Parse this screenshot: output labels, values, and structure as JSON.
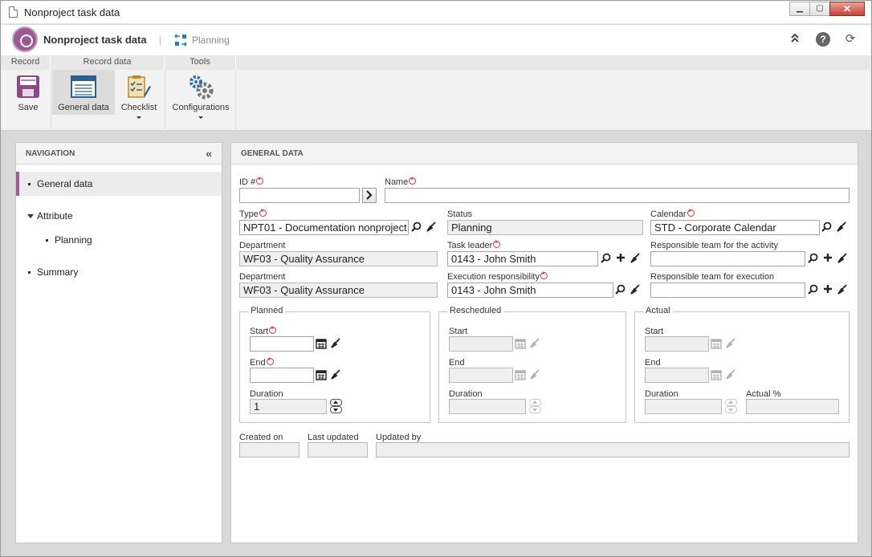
{
  "window": {
    "title": "Nonproject task data",
    "minimize": "▁",
    "maximize": "▢",
    "close": "✕"
  },
  "appbar": {
    "title": "Nonproject task data",
    "separator": "|",
    "breadcrumb": "Planning",
    "collapse_icon": "«",
    "help_icon": "?",
    "refresh_icon": "⟳",
    "up_icon": "⌃"
  },
  "ribbon": {
    "groups": [
      "Record",
      "Record data",
      "Tools"
    ],
    "buttons": {
      "save": "Save",
      "general_data": "General data",
      "checklist": "Checklist",
      "configurations": "Configurations"
    }
  },
  "navigation": {
    "heading": "NAVIGATION",
    "collapse_icon": "«",
    "items": [
      {
        "label": "General data",
        "active": true
      },
      {
        "label": "Attribute"
      },
      {
        "label": "Planning"
      },
      {
        "label": "Summary"
      }
    ]
  },
  "general": {
    "heading": "GENERAL DATA",
    "id_label": "ID #",
    "id_value": "",
    "name_label": "Name",
    "name_value": "",
    "type_label": "Type",
    "type_value": "NPT01 - Documentation nonproject",
    "status_label": "Status",
    "status_value": "Planning",
    "calendar_label": "Calendar",
    "calendar_value": "STD - Corporate Calendar",
    "department_label": "Department",
    "department_value": "WF03 - Quality Assurance",
    "task_leader_label": "Task leader",
    "task_leader_value": "0143 - John Smith",
    "resp_team_activity_label": "Responsible team for the activity",
    "resp_team_activity_value": "",
    "department2_label": "Department",
    "department2_value": "WF03 - Quality Assurance",
    "exec_resp_label": "Execution responsibility",
    "exec_resp_value": "0143 - John Smith",
    "resp_team_exec_label": "Responsible team for execution",
    "resp_team_exec_value": "",
    "planned": {
      "title": "Planned",
      "start_label": "Start",
      "start_value": "",
      "end_label": "End",
      "end_value": "",
      "duration_label": "Duration",
      "duration_value": "1"
    },
    "rescheduled": {
      "title": "Rescheduled",
      "start_label": "Start",
      "end_label": "End",
      "duration_label": "Duration"
    },
    "actual": {
      "title": "Actual",
      "start_label": "Start",
      "end_label": "End",
      "duration_label": "Duration",
      "actual_pct_label": "Actual %"
    },
    "created_on_label": "Created on",
    "created_on_value": "",
    "last_updated_label": "Last updated",
    "last_updated_value": "",
    "updated_by_label": "Updated by",
    "updated_by_value": ""
  },
  "colors": {
    "accent": "#9b5a93",
    "required": "#dd3333",
    "header_bg": "#f3f3f3"
  },
  "icons": [
    "document-icon",
    "app-logo-icon",
    "planning-icon",
    "collapse-up-icon",
    "help-icon",
    "refresh-icon",
    "save-icon",
    "general-data-icon",
    "checklist-icon",
    "configurations-icon",
    "search-icon",
    "clear-icon",
    "add-icon",
    "calendar-icon",
    "next-arrow-icon",
    "spinner-icon"
  ]
}
